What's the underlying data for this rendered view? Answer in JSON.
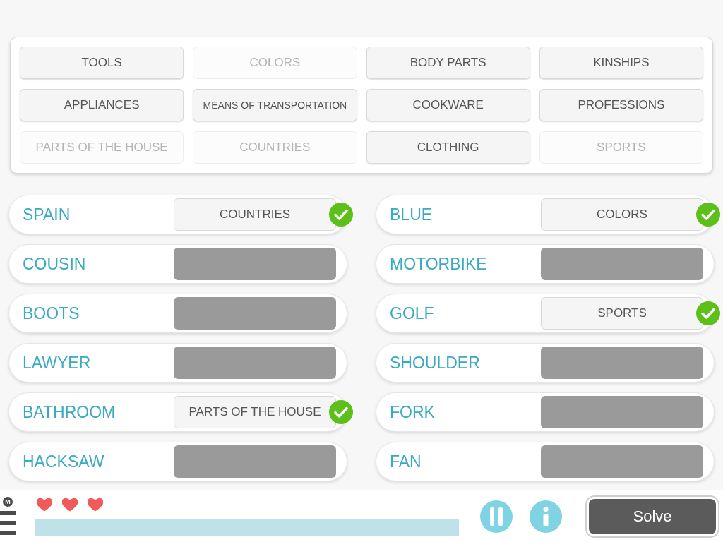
{
  "categories": [
    {
      "label": "TOOLS",
      "disabled": false
    },
    {
      "label": "COLORS",
      "disabled": true
    },
    {
      "label": "BODY PARTS",
      "disabled": false
    },
    {
      "label": "KINSHIPS",
      "disabled": false
    },
    {
      "label": "APPLIANCES",
      "disabled": false
    },
    {
      "label": "MEANS OF TRANSPORTATION",
      "disabled": false
    },
    {
      "label": "COOKWARE",
      "disabled": false
    },
    {
      "label": "PROFESSIONS",
      "disabled": false
    },
    {
      "label": "PARTS OF THE HOUSE",
      "disabled": true
    },
    {
      "label": "COUNTRIES",
      "disabled": true
    },
    {
      "label": "CLOTHING",
      "disabled": false
    },
    {
      "label": "SPORTS",
      "disabled": true
    }
  ],
  "word_columns": [
    {
      "items": [
        {
          "word": "SPAIN",
          "answer": "COUNTRIES",
          "correct": true
        },
        {
          "word": "COUSIN",
          "correct": false
        },
        {
          "word": "BOOTS",
          "correct": false
        },
        {
          "word": "LAWYER",
          "correct": false
        },
        {
          "word": "BATHROOM",
          "answer": "PARTS OF THE HOUSE",
          "correct": true
        },
        {
          "word": "HACKSAW",
          "correct": false
        }
      ]
    },
    {
      "items": [
        {
          "word": "BLUE",
          "answer": "COLORS",
          "correct": true
        },
        {
          "word": "MOTORBIKE",
          "correct": false
        },
        {
          "word": "GOLF",
          "answer": "SPORTS",
          "correct": true
        },
        {
          "word": "SHOULDER",
          "correct": false
        },
        {
          "word": "FORK",
          "correct": false
        },
        {
          "word": "FAN",
          "correct": false
        }
      ]
    }
  ],
  "footer": {
    "menu_badge": "M",
    "lives": [
      {
        "filled": true
      },
      {
        "filled": true
      },
      {
        "filled": true
      }
    ],
    "timer": {
      "level": 1
    },
    "solve_button": "Solve"
  }
}
